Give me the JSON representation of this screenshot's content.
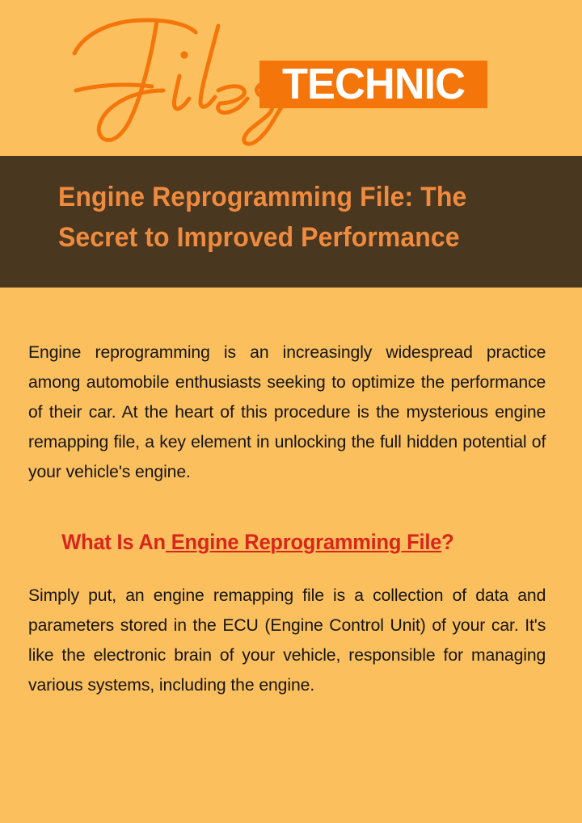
{
  "page": {
    "background_color": "#fbbf5e",
    "body_text_color": "#151515"
  },
  "logo": {
    "script_word": "Files",
    "badge_word": "TECHNIC",
    "script_color": "#f4760b",
    "badge_bg_color": "#f4760b",
    "badge_text_color": "#ffffff"
  },
  "title_banner": {
    "background_color": "#4a3720",
    "text_color": "#ef8b3e",
    "title": "Engine Reprogramming File: The\nSecret to Improved Performance"
  },
  "article": {
    "paragraph_1": "Engine reprogramming is an increasingly widespread practice among automobile enthusiasts seeking to optimize the performance of their car. At the heart of this procedure is the mysterious engine remapping file, a key element in unlocking the full hidden potential of your vehicle's engine.",
    "heading": {
      "color": "#d9261c",
      "prefix": "What Is An",
      "link_text": " Engine Reprogramming File",
      "suffix": "?"
    },
    "paragraph_2": "Simply put, an engine remapping file is a collection of data and parameters stored in the ECU (Engine Control Unit) of your car. It's like the electronic brain of your vehicle, responsible for managing various systems, including the engine."
  }
}
